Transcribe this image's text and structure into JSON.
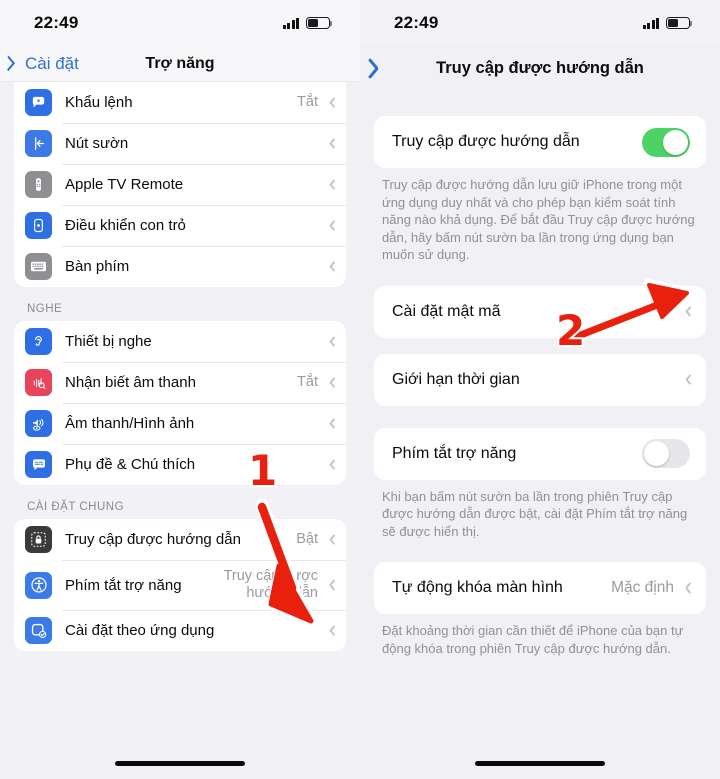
{
  "left": {
    "status": {
      "time": "22:49",
      "battery_level": "50"
    },
    "nav": {
      "back_label": "Cài đặt",
      "title": "Trợ năng"
    },
    "groups": [
      {
        "header": "",
        "rows": [
          {
            "icon": "voice-control-icon",
            "label": "Khẩu lệnh",
            "value": "Tắt"
          },
          {
            "icon": "side-button-icon",
            "label": "Nút sườn",
            "value": ""
          },
          {
            "icon": "apple-tv-remote-icon",
            "label": "Apple TV Remote",
            "value": ""
          },
          {
            "icon": "pointer-control-icon",
            "label": "Điều khiển con trỏ",
            "value": ""
          },
          {
            "icon": "keyboard-icon",
            "label": "Bàn phím",
            "value": ""
          }
        ]
      },
      {
        "header": "NGHE",
        "rows": [
          {
            "icon": "hearing-device-icon",
            "label": "Thiết bị nghe",
            "value": ""
          },
          {
            "icon": "sound-recognition-icon",
            "label": "Nhận biết âm thanh",
            "value": "Tắt"
          },
          {
            "icon": "audio-visual-icon",
            "label": "Âm thanh/Hình ảnh",
            "value": ""
          },
          {
            "icon": "subtitles-icon",
            "label": "Phụ đề & Chú thích",
            "value": ""
          }
        ]
      },
      {
        "header": "CÀI ĐẶT CHUNG",
        "rows": [
          {
            "icon": "guided-access-icon",
            "label": "Truy cập được hướng dẫn",
            "value": "Bật"
          },
          {
            "icon": "accessibility-shortcut-icon",
            "label": "Phím tắt trợ năng",
            "value": "Truy cập được\nhướng dẫn"
          },
          {
            "icon": "per-app-settings-icon",
            "label": "Cài đặt theo ứng dụng",
            "value": ""
          }
        ]
      }
    ]
  },
  "right": {
    "status": {
      "time": "22:49",
      "battery_level": "50"
    },
    "nav": {
      "title": "Truy cập được hướng dẫn"
    },
    "toggle_row": {
      "label": "Truy cập được hướng dẫn",
      "state": "on"
    },
    "toggle_footnote": "Truy cập được hướng dẫn lưu giữ iPhone trong một ứng dụng duy nhất và cho phép bạn kiểm soát tính năng nào khả dụng. Để bắt đầu Truy cập được hướng dẫn, hãy bấm nút sườn ba lần trong ứng dụng bạn muốn sử dụng.",
    "passcode_row": {
      "label": "Cài đặt mật mã"
    },
    "time_limit_row": {
      "label": "Giới hạn thời gian"
    },
    "shortcut_row": {
      "label": "Phím tắt trợ năng",
      "state": "off"
    },
    "shortcut_footnote": "Khi bạn bấm nút sườn ba lần trong phiên Truy cập được hướng dẫn được bật, cài đặt Phím tắt trợ năng sẽ được hiển thị.",
    "autolock_row": {
      "label": "Tự động khóa màn hình",
      "value": "Mặc định"
    },
    "autolock_footnote": "Đặt khoảng thời gian cần thiết để iPhone của bạn tự động khóa trong phiên Truy cập được hướng dẫn."
  },
  "annotations": {
    "step1": "1",
    "step2": "2",
    "arrow_color": "#e8200e"
  }
}
